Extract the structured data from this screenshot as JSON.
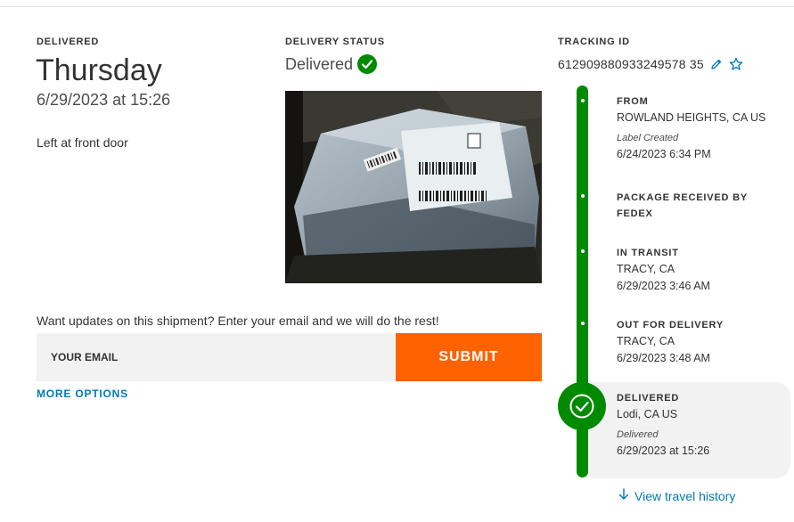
{
  "delivery": {
    "label": "DELIVERED",
    "day": "Thursday",
    "datetime": "6/29/2023 at 15:26",
    "note": "Left at front door"
  },
  "status": {
    "label": "DELIVERY STATUS",
    "text": "Delivered",
    "icon": "check-circle-icon",
    "color": "#008a00"
  },
  "tracking": {
    "label": "TRACKING ID",
    "number": "612909880933249578 35",
    "edit_icon": "pencil-icon",
    "favorite_icon": "star-outline-icon"
  },
  "signup": {
    "prompt": "Want updates on this shipment? Enter your email and we will do the rest!",
    "placeholder": "YOUR EMAIL",
    "submit_label": "SUBMIT",
    "more_options": "MORE OPTIONS",
    "submit_color": "#ff6200",
    "link_color": "#007ab7"
  },
  "timeline": {
    "events": [
      {
        "title": "FROM",
        "location": "ROWLAND HEIGHTS, CA US",
        "sublabel": "Label Created",
        "time": "6/24/2023 6:34 PM"
      },
      {
        "title": "PACKAGE RECEIVED BY FEDEX",
        "location": "",
        "sublabel": "",
        "time": ""
      },
      {
        "title": "IN TRANSIT",
        "location": "TRACY, CA",
        "sublabel": "",
        "time": "6/29/2023 3:46 AM"
      },
      {
        "title": "OUT FOR DELIVERY",
        "location": "TRACY, CA",
        "sublabel": "",
        "time": "6/29/2023 3:48 AM"
      },
      {
        "title": "DELIVERED",
        "location": "Lodi, CA US",
        "sublabel": "Delivered",
        "time": "6/29/2023 at 15:26"
      }
    ],
    "view_history": "View travel history"
  }
}
